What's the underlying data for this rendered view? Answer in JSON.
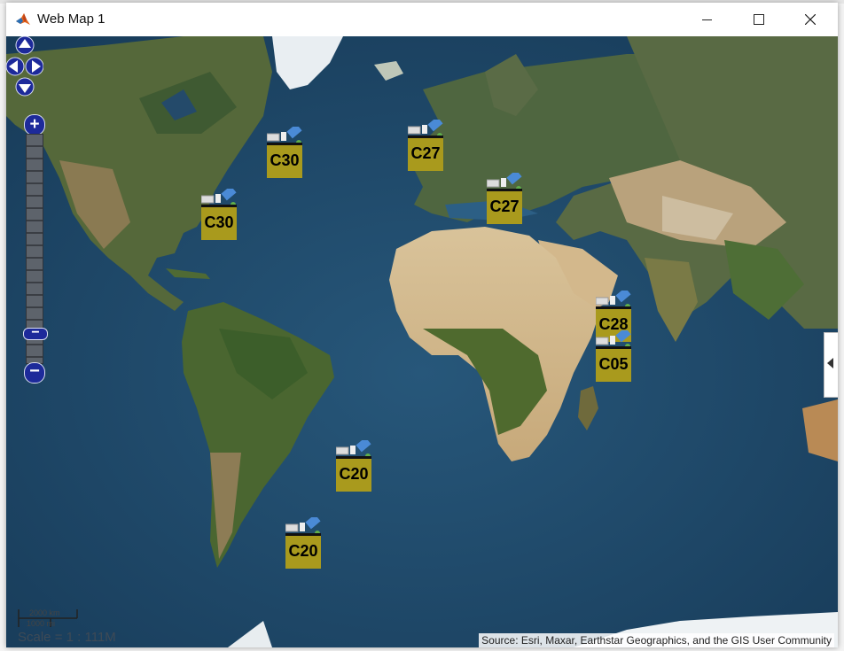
{
  "window": {
    "title": "Web Map 1",
    "minimize_icon": "minimize-icon",
    "maximize_icon": "maximize-icon",
    "close_icon": "close-icon"
  },
  "map": {
    "markers": [
      {
        "label": "C30"
      },
      {
        "label": "C30"
      },
      {
        "label": "C27"
      },
      {
        "label": "C27"
      },
      {
        "label": "C28"
      },
      {
        "label": "C05"
      },
      {
        "label": "C20"
      },
      {
        "label": "C20"
      }
    ],
    "scale": {
      "km": "2000 km",
      "mi": "1000 mi",
      "ratio": "Scale = 1 : 111M"
    },
    "attribution": "Source: Esri, Maxar, Earthstar Geographics, and the GIS User Community"
  },
  "colors": {
    "ocean": "#1f4b6e",
    "marker_fill": "#a99a1d",
    "nav_blue": "#1d2a9a"
  }
}
